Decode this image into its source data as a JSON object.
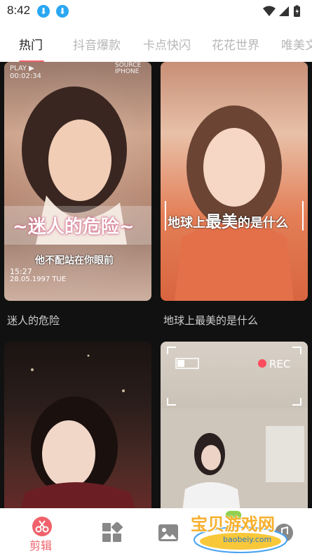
{
  "status_bar": {
    "time": "8:42"
  },
  "tabs": [
    {
      "label": "热门",
      "active": true
    },
    {
      "label": "抖音爆款",
      "active": false
    },
    {
      "label": "卡点快闪",
      "active": false
    },
    {
      "label": "花花世界",
      "active": false
    },
    {
      "label": "唯美文",
      "active": false
    }
  ],
  "cards": [
    {
      "caption": "迷人的危险",
      "overlay_title": "~迷人的危险~",
      "overlay_sub": "他不配站在你眼前",
      "overlay_top_left": "PLAY ▶",
      "overlay_top_time": "00:02:34",
      "overlay_top_right_1": "SOURCE",
      "overlay_top_right_2": "IPHONE",
      "overlay_time": "15:27",
      "overlay_date": "28.05.1997 TUE"
    },
    {
      "caption": "地球上最美的是什么",
      "overlay_title_a": "地球上",
      "overlay_title_b": "最美",
      "overlay_title_c": "的是什么"
    },
    {
      "caption": ""
    },
    {
      "caption": "",
      "overlay_rec": "REC"
    }
  ],
  "bottom_nav": {
    "items": [
      {
        "label": "剪辑",
        "icon": "scissors-icon",
        "active": true
      },
      {
        "label": "",
        "icon": "templates-icon",
        "active": false
      },
      {
        "label": "",
        "icon": "image-icon",
        "active": false
      },
      {
        "label": "",
        "icon": "music-icon",
        "active": false
      }
    ]
  },
  "watermark": {
    "text": "宝贝游戏网",
    "url": "baobeiy.com"
  },
  "colors": {
    "accent": "#f0616b",
    "download_badge": "#2aa7f2",
    "content_bg": "#111111"
  }
}
